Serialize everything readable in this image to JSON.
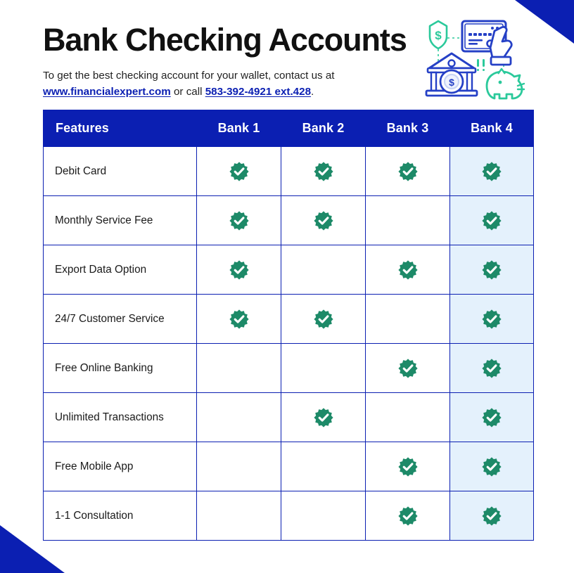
{
  "header": {
    "title": "Bank Checking Accounts",
    "subtitle_lead": "To get the best checking account for your wallet, contact us at ",
    "website": "www.financialexpert.com",
    "subtitle_mid": " or call ",
    "phone": "583-392-4921 ext.428",
    "subtitle_end": "."
  },
  "illustration": {
    "name": "banking-illustration",
    "elements": [
      "bank-building-icon",
      "credit-card-icon",
      "hand-icon",
      "piggy-bank-icon",
      "dollar-shield-icon",
      "dollar-coin-icon"
    ]
  },
  "colors": {
    "brand_blue": "#0b1fb2",
    "check_green": "#1d8a68",
    "highlight_blue": "#e4f1fc",
    "header_text": "#ffffff",
    "body_text": "#1a1a1a"
  },
  "table": {
    "columns": [
      "Features",
      "Bank 1",
      "Bank 2",
      "Bank 3",
      "Bank 4"
    ],
    "highlight_column_index": 4,
    "check_icon_name": "verified-check-badge-icon",
    "rows": [
      {
        "feature": "Debit Card",
        "checks": [
          true,
          true,
          true,
          true
        ]
      },
      {
        "feature": "Monthly Service Fee",
        "checks": [
          true,
          true,
          false,
          true
        ]
      },
      {
        "feature": "Export Data Option",
        "checks": [
          true,
          false,
          true,
          true
        ]
      },
      {
        "feature": "24/7 Customer Service",
        "checks": [
          true,
          true,
          false,
          true
        ]
      },
      {
        "feature": "Free Online Banking",
        "checks": [
          false,
          false,
          true,
          true
        ]
      },
      {
        "feature": "Unlimited Transactions",
        "checks": [
          false,
          true,
          false,
          true
        ]
      },
      {
        "feature": "Free Mobile App",
        "checks": [
          false,
          false,
          true,
          true
        ]
      },
      {
        "feature": "1-1 Consultation",
        "checks": [
          false,
          false,
          true,
          true
        ]
      }
    ]
  }
}
